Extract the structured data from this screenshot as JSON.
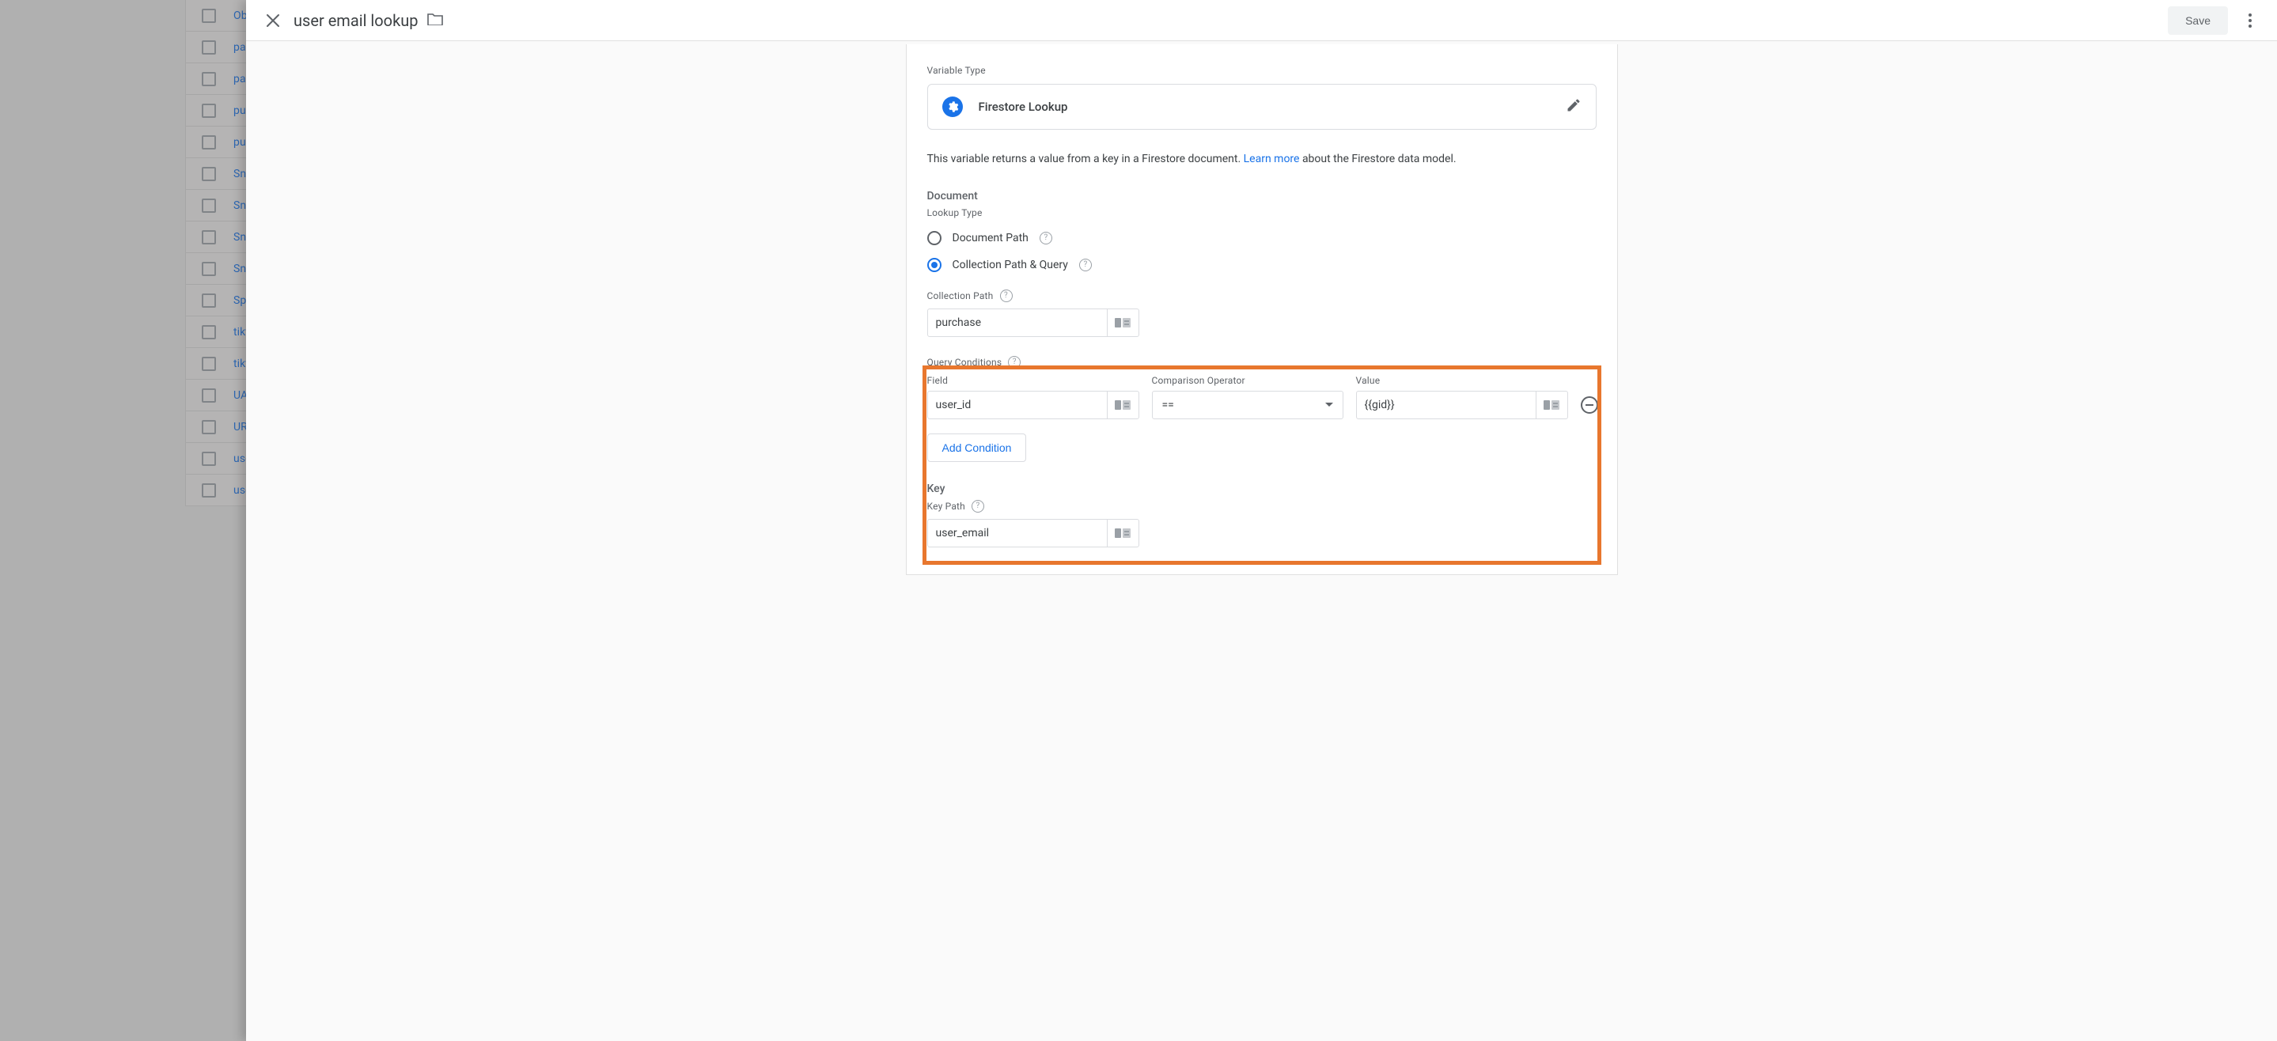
{
  "header": {
    "title": "user email lookup",
    "save": "Save"
  },
  "variableType": {
    "label": "Variable Type",
    "name": "Firestore Lookup"
  },
  "description": {
    "prefix": "This variable returns a value from a key in a Firestore document. ",
    "link": "Learn more",
    "suffix": " about the Firestore data model."
  },
  "document": {
    "sectionTitle": "Document",
    "lookupTypeLabel": "Lookup Type",
    "radioDocPath": "Document Path",
    "radioCollection": "Collection Path & Query",
    "collectionPathLabel": "Collection Path",
    "collectionPathValue": "purchase"
  },
  "conditions": {
    "label": "Query Conditions",
    "fieldLabel": "Field",
    "operatorLabel": "Comparison Operator",
    "valueLabel": "Value",
    "row": {
      "field": "user_id",
      "operator": "==",
      "value": "{{gid}}"
    },
    "addButton": "Add Condition"
  },
  "key": {
    "sectionTitle": "Key",
    "keyPathLabel": "Key Path",
    "keyPathValue": "user_email"
  },
  "backdropItems": [
    "Ob",
    "pag",
    "pag",
    "pur",
    "pur",
    "Sna",
    "Sna",
    "Sna",
    "Sna",
    "Spr",
    "tikt",
    "tikt",
    "UA",
    "UR",
    "use",
    "use"
  ]
}
